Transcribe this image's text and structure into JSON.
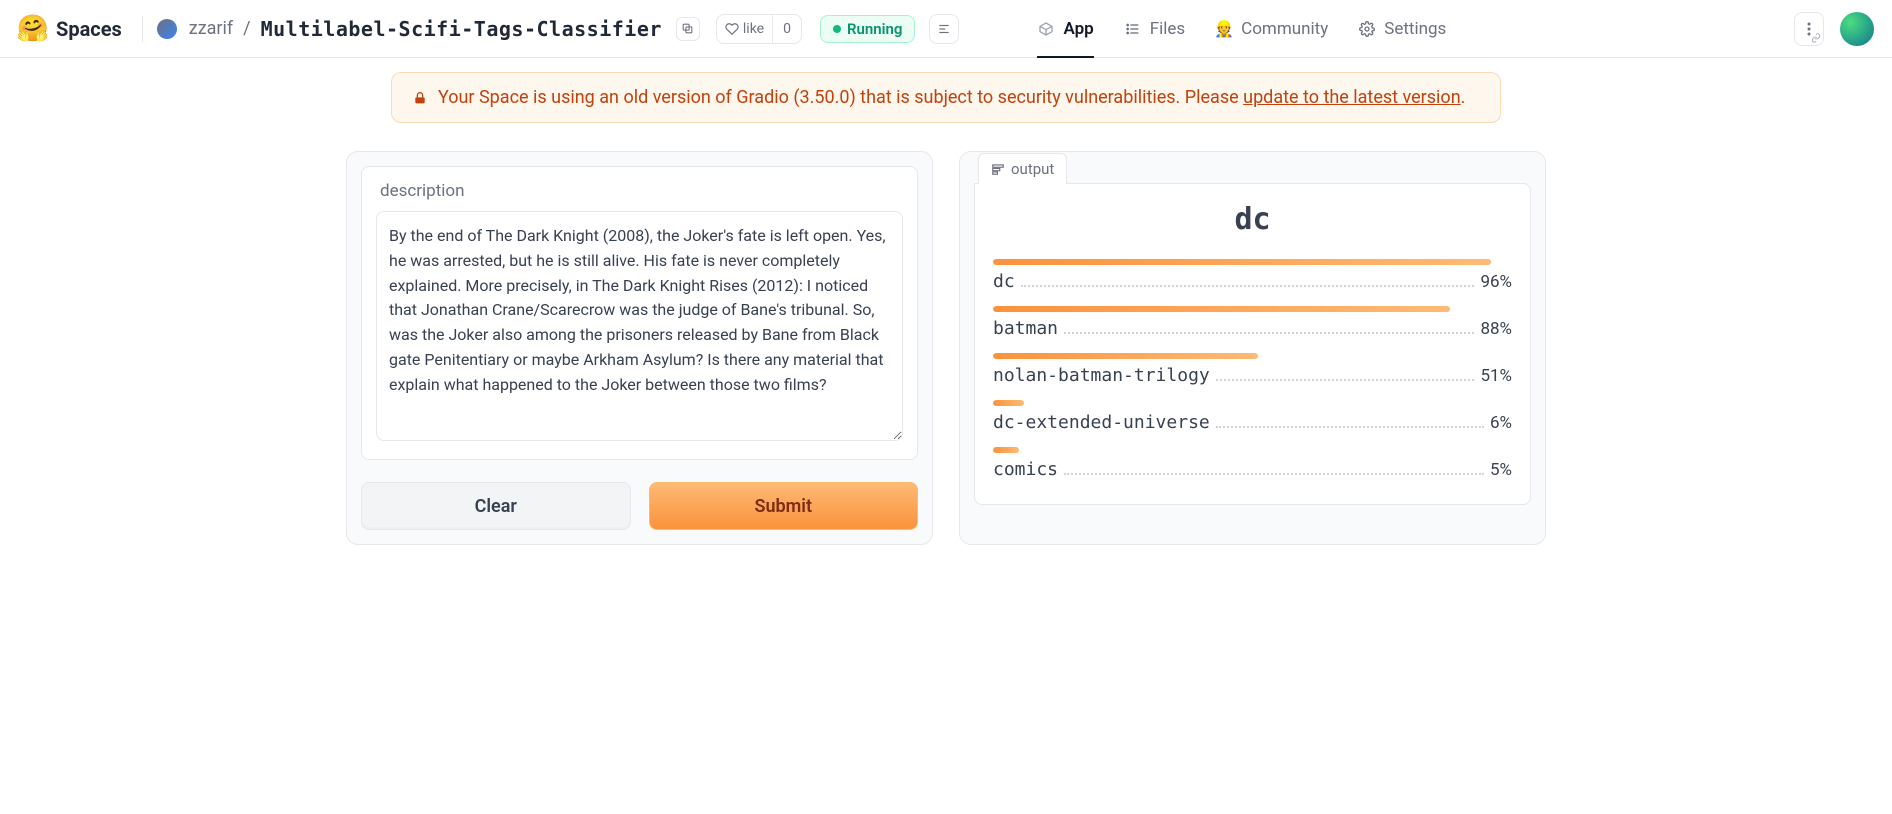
{
  "header": {
    "spaces_label": "Spaces",
    "owner": "zzarif",
    "space_name": "Multilabel-Scifi-Tags-Classifier",
    "like_label": "like",
    "like_count": "0",
    "status_label": "Running"
  },
  "nav": {
    "app": "App",
    "files": "Files",
    "community": "Community",
    "settings": "Settings"
  },
  "banner": {
    "prefix": "Your Space is using an old version of Gradio (3.50.0) that is subject to security vulnerabilities. Please ",
    "link_text": "update to the latest version",
    "suffix": "."
  },
  "input": {
    "label": "description",
    "value": "By the end of The Dark Knight (2008), the Joker's fate is left open. Yes, he was arrested, but he is still alive. His fate is never completely explained. More precisely, in The Dark Knight Rises (2012): I noticed that Jonathan Crane/Scarecrow was the judge of Bane's tribunal. So, was the Joker also among the prisoners released by Bane from Black gate Penitentiary or maybe Arkham Asylum? Is there any material that explain what happened to the Joker between those two films?"
  },
  "buttons": {
    "clear": "Clear",
    "submit": "Submit"
  },
  "output": {
    "tab_label": "output",
    "top_label": "dc",
    "results": [
      {
        "label": "dc",
        "pct": 96
      },
      {
        "label": "batman",
        "pct": 88
      },
      {
        "label": "nolan-batman-trilogy",
        "pct": 51
      },
      {
        "label": "dc-extended-universe",
        "pct": 6
      },
      {
        "label": "comics",
        "pct": 5
      }
    ]
  },
  "chart_data": {
    "type": "bar",
    "title": "dc",
    "xlabel": "",
    "ylabel": "",
    "ylim": [
      0,
      100
    ],
    "categories": [
      "dc",
      "batman",
      "nolan-batman-trilogy",
      "dc-extended-universe",
      "comics"
    ],
    "values": [
      96,
      88,
      51,
      6,
      5
    ]
  }
}
